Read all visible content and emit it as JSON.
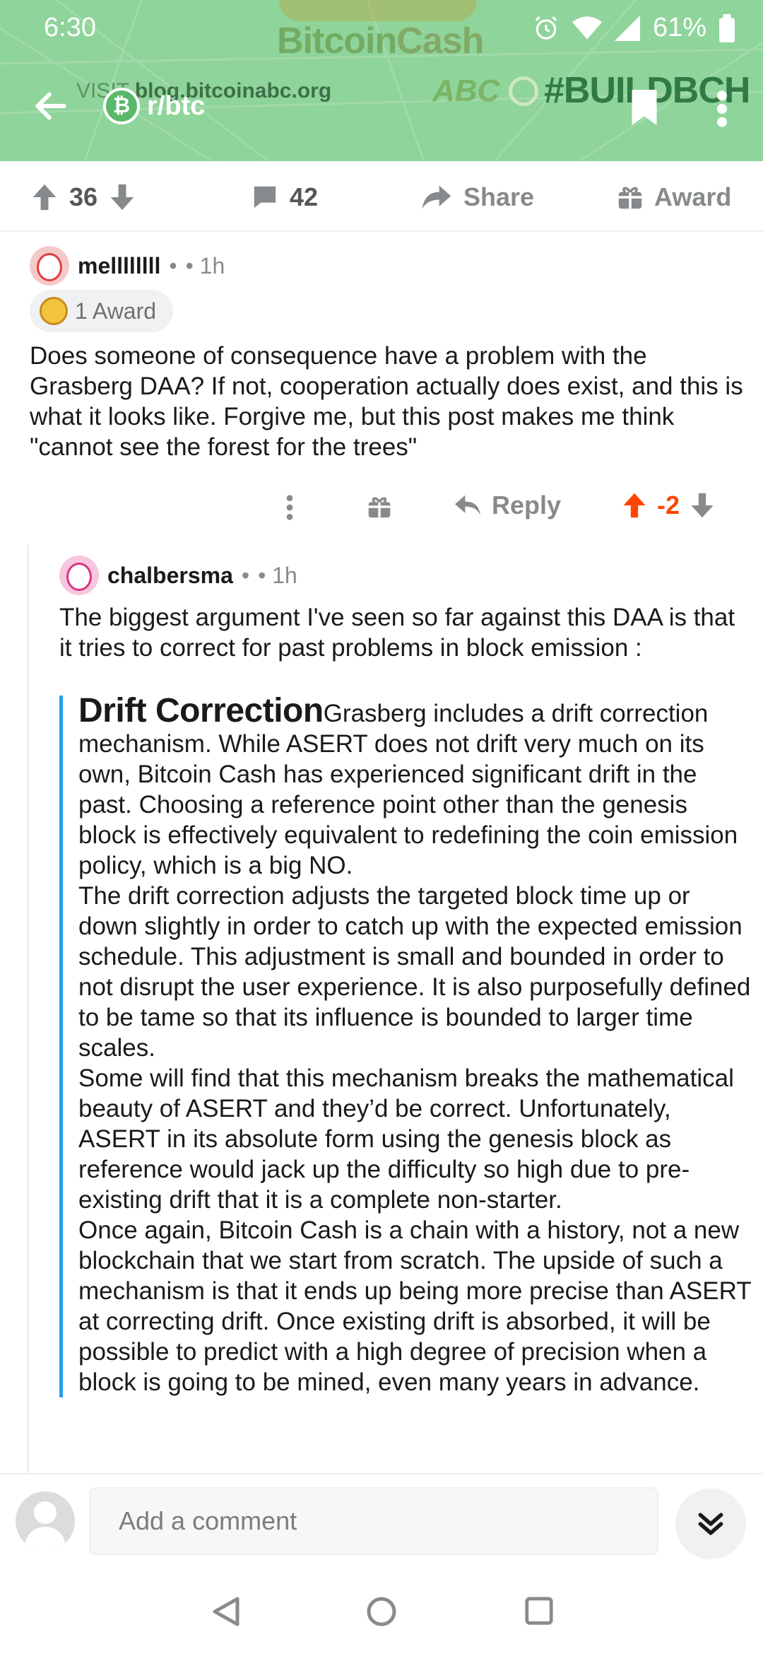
{
  "status_bar": {
    "time": "6:30",
    "battery": "61%"
  },
  "banner": {
    "brand_bitcoin": "Bitcoin",
    "brand_cash": "Cash",
    "visit_prefix": "VISIT",
    "visit_url": "blog.bitcoinabc.org",
    "abc": "ABC",
    "hashtag": "#BUILDBCH"
  },
  "header": {
    "subreddit": "r/btc",
    "subreddit_icon_glyph": "₿"
  },
  "post_actions": {
    "vote_count": "36",
    "comments_count": "42",
    "share_label": "Share",
    "award_label": "Award"
  },
  "comment_1": {
    "author": "mellllllll",
    "separator": "•",
    "time": "• 1h",
    "award_label": "1 Award",
    "body": "Does someone of consequence have a problem with the Grasberg DAA? If not, cooperation actually does exist, and this is what it looks like. Forgive me, but this post makes me think \"cannot see the forest for the trees\"",
    "reply_label": "Reply",
    "score": "-2"
  },
  "comment_2": {
    "author": "chalbersma",
    "separator": "•",
    "time": "• 1h",
    "body": "The biggest argument I've seen so far against this DAA is that it tries to correct for past problems in block emission :",
    "quote_title": "Drift Correction",
    "quote_p1": "Grasberg includes a drift correction mechanism. While ASERT does not drift very much on its own, Bitcoin Cash has experienced significant drift in the past. Choosing a reference point other than the genesis block is effectively equivalent to redefining the coin emission policy, which is a big NO.",
    "quote_p2": "The drift correction adjusts the targeted block time up or down slightly in order to catch up with the expected emission schedule. This adjustment is small and bounded in order to not disrupt the user experience. It is also purposefully defined to be tame so that its influence is bounded to larger time scales.",
    "quote_p3": "Some will find that this mechanism breaks the mathematical beauty of ASERT and they’d be correct. Unfortunately, ASERT in its absolute form using the genesis block as reference would jack up the difficulty so high due to pre-existing drift that it is a complete non-starter.",
    "quote_p4": "Once again, Bitcoin Cash is a chain with a history, not a new blockchain that we start from scratch. The upside of such a mechanism is that it ends up being more precise than ASERT at correcting drift. Once existing drift is absorbed, it will be possible to predict with a high degree of precision when a block is going to be mined, even many years in advance."
  },
  "comment_bar": {
    "placeholder": "Add a comment"
  },
  "colors": {
    "header_bg": "#8fd49a",
    "upvote_active": "#ff4500",
    "quote_bar": "#24a0ed",
    "muted": "#878a8c"
  },
  "icons": {
    "status": [
      "alarm-icon",
      "wifi-icon",
      "signal-icon",
      "battery-icon"
    ],
    "nav": [
      "back-arrow-icon",
      "bookmark-icon",
      "more-vertical-icon"
    ],
    "android": [
      "android-back-icon",
      "android-home-icon",
      "android-recents-icon"
    ]
  }
}
